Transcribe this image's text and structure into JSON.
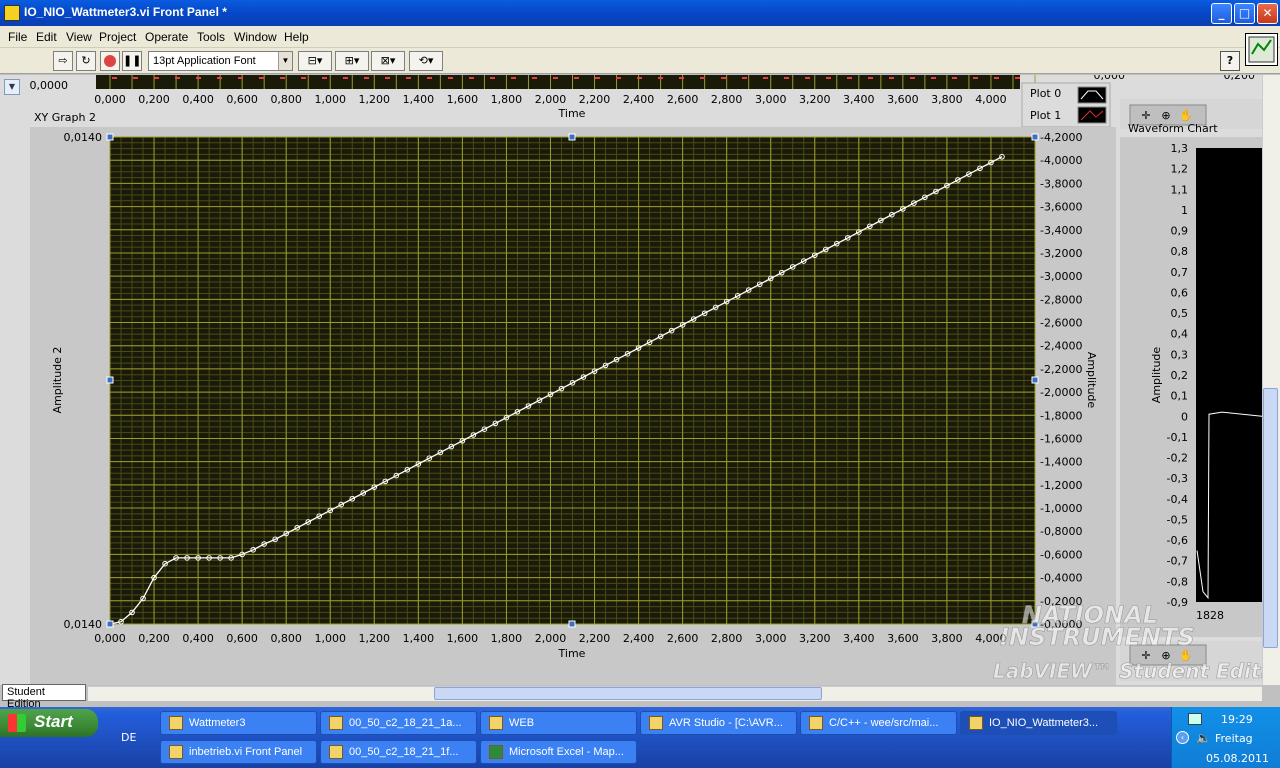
{
  "window": {
    "title": "IO_NIO_Wattmeter3.vi Front Panel *",
    "min": "_",
    "max": "□",
    "close": "✕"
  },
  "menu": [
    "File",
    "Edit",
    "View",
    "Project",
    "Operate",
    "Tools",
    "Window",
    "Help"
  ],
  "toolbar": {
    "font": "13pt Application Font",
    "help": "?"
  },
  "top_graph": {
    "x_ticks": [
      "0,000",
      "0,200",
      "0,400",
      "0,600",
      "0,800",
      "1,000",
      "1,200",
      "1,400",
      "1,600",
      "1,800",
      "2,000",
      "2,200",
      "2,400",
      "2,600",
      "2,800",
      "3,000",
      "3,200",
      "3,400",
      "3,600",
      "3,800",
      "4,000"
    ],
    "x_label": "Time",
    "y_top_label": "0,0000",
    "legend": [
      "Plot 0",
      "Plot 1"
    ]
  },
  "xy_graph": {
    "caption": "XY Graph 2",
    "left_axis_label": "Amplitude 2",
    "right_axis_label": "Amplitude",
    "left_ticks": [
      "0,0140",
      "0,0140"
    ],
    "right_ticks": [
      "4,2000",
      "4,0000",
      "3,8000",
      "3,6000",
      "3,4000",
      "3,2000",
      "3,0000",
      "2,8000",
      "2,6000",
      "2,4000",
      "2,2000",
      "2,0000",
      "1,8000",
      "1,6000",
      "1,4000",
      "1,2000",
      "1,0000",
      "0,8000",
      "0,6000",
      "0,4000",
      "0,2000",
      "0,0000"
    ],
    "x_ticks": [
      "0,000",
      "0,200",
      "0,400",
      "0,600",
      "0,800",
      "1,000",
      "1,200",
      "1,400",
      "1,600",
      "1,800",
      "2,000",
      "2,200",
      "2,400",
      "2,600",
      "2,800",
      "3,000",
      "3,200",
      "3,400",
      "3,600",
      "3,800",
      "4,000"
    ],
    "x_label": "Time",
    "colors": {
      "plot_bg": "#1a1a08",
      "grid_major": "#9c9c2a",
      "grid_minor": "#4a4a18",
      "trace": "#ffffff"
    }
  },
  "chart_data": {
    "type": "line",
    "title": "",
    "xlabel": "Time",
    "ylabel": "Amplitude",
    "xlim": [
      0,
      4.2
    ],
    "ylim": [
      0,
      4.2
    ],
    "series": [
      {
        "x": [
          0,
          0.05,
          0.1,
          0.15,
          0.2,
          0.25,
          0.3,
          0.35,
          0.4,
          0.45,
          0.5,
          0.55,
          0.6,
          0.65,
          0.7,
          0.75,
          0.8,
          0.85,
          0.9,
          0.95,
          1.0,
          1.05,
          1.1,
          1.15,
          1.2,
          1.25,
          1.3,
          1.35,
          1.4,
          1.45,
          1.5,
          1.55,
          1.6,
          1.65,
          1.7,
          1.75,
          1.8,
          1.85,
          1.9,
          1.95,
          2.0,
          2.05,
          2.1,
          2.15,
          2.2,
          2.25,
          2.3,
          2.35,
          2.4,
          2.45,
          2.5,
          2.55,
          2.6,
          2.65,
          2.7,
          2.75,
          2.8,
          2.85,
          2.9,
          2.95,
          3.0,
          3.05,
          3.1,
          3.15,
          3.2,
          3.25,
          3.3,
          3.35,
          3.4,
          3.45,
          3.5,
          3.55,
          3.6,
          3.65,
          3.7,
          3.75,
          3.8,
          3.85,
          3.9,
          3.95,
          4.0,
          4.05
        ],
        "values": [
          0,
          0.02,
          0.1,
          0.22,
          0.4,
          0.52,
          0.57,
          0.57,
          0.57,
          0.57,
          0.57,
          0.57,
          0.6,
          0.64,
          0.69,
          0.73,
          0.78,
          0.83,
          0.88,
          0.93,
          0.98,
          1.03,
          1.08,
          1.13,
          1.18,
          1.23,
          1.28,
          1.33,
          1.38,
          1.43,
          1.48,
          1.53,
          1.58,
          1.63,
          1.68,
          1.73,
          1.78,
          1.83,
          1.88,
          1.93,
          1.98,
          2.03,
          2.08,
          2.13,
          2.18,
          2.23,
          2.28,
          2.33,
          2.38,
          2.43,
          2.48,
          2.53,
          2.58,
          2.63,
          2.68,
          2.73,
          2.78,
          2.83,
          2.88,
          2.93,
          2.98,
          3.03,
          3.08,
          3.13,
          3.18,
          3.23,
          3.28,
          3.33,
          3.38,
          3.43,
          3.48,
          3.53,
          3.58,
          3.63,
          3.68,
          3.73,
          3.78,
          3.83,
          3.88,
          3.93,
          3.98,
          4.03
        ]
      }
    ]
  },
  "waveform_chart": {
    "caption": "Waveform Chart",
    "ylabel": "Amplitude",
    "y_ticks": [
      "1,3",
      "1,2",
      "1,1",
      "1",
      "0,9",
      "0,8",
      "0,7",
      "0,6",
      "0,5",
      "0,4",
      "0,3",
      "0,2",
      "0,1",
      "0",
      "-0,1",
      "-0,2",
      "-0,3",
      "-0,4",
      "-0,5",
      "-0,6",
      "-0,7",
      "-0,8",
      "-0,9"
    ],
    "x_start": "1828",
    "top_values": [
      "0,000",
      "0,200"
    ]
  },
  "watermark": {
    "line1": "NATIONAL",
    "line2": "INSTRUMENTS",
    "line3": "LabVIEW™ Student Edition"
  },
  "status": {
    "student_label": "Student Edition"
  },
  "taskbar": {
    "start": "Start",
    "lang": "DE",
    "tasks_row1": [
      "Wattmeter3",
      "00_50_c2_18_21_1a...",
      "WEB",
      "AVR Studio - [C:\\AVR...",
      "C/C++ - wee/src/mai...",
      "IO_NIO_Wattmeter3..."
    ],
    "tasks_row2": [
      "inbetrieb.vi Front Panel",
      "00_50_c2_18_21_1f...",
      "Microsoft Excel - Map..."
    ],
    "clock": "19:29",
    "day": "Freitag",
    "date": "05.08.2011"
  }
}
